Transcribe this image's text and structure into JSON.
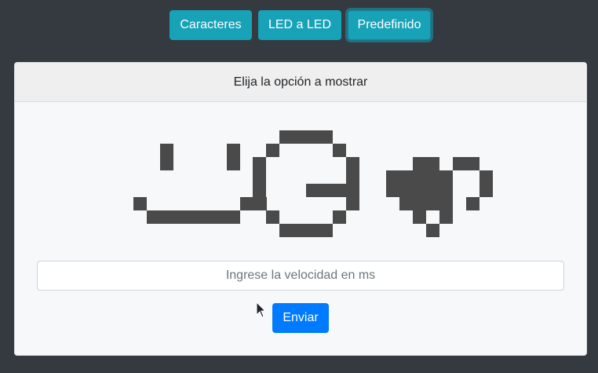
{
  "nav": {
    "buttons": [
      {
        "label": "Caracteres",
        "active": false
      },
      {
        "label": "LED a LED",
        "active": false
      },
      {
        "label": "Predefinido",
        "active": true
      }
    ]
  },
  "card": {
    "header": "Elija la opción a mostrar",
    "patterns": [
      {
        "name": "smiley",
        "rows": [
          "..........",
          "..#....#..",
          "..#....#..",
          "..........",
          "..........",
          "#.......##",
          ".#######.."
        ]
      },
      {
        "name": "g-letter",
        "rows": [
          "...####..",
          "..#....#.",
          ".#......#",
          ".#......#",
          ".#...####",
          ".#......#",
          "..#....#.",
          "...####.."
        ]
      },
      {
        "name": "heart",
        "rows": [
          "...##.##.",
          ".#####..#",
          ".#####..#",
          "..####.#.",
          "...#.#...",
          "....#...."
        ]
      }
    ],
    "speed_input": {
      "placeholder": "Ingrese la velocidad en ms",
      "value": ""
    },
    "send_label": "Enviar"
  },
  "colors": {
    "background": "#343a40",
    "info_button": "#17a2b8",
    "primary_button": "#007bff",
    "led_on": "#4a4a4a"
  }
}
